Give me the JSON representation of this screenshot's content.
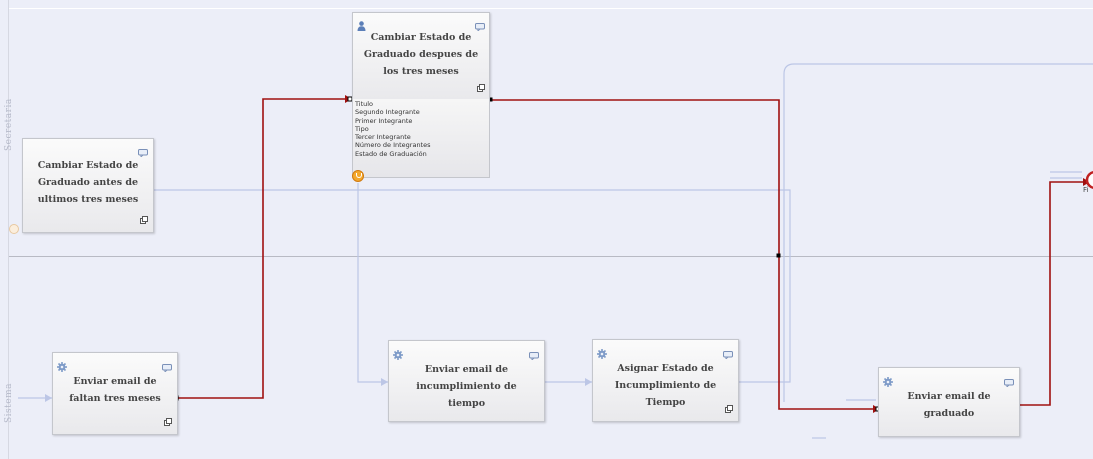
{
  "lanes": [
    {
      "name": "Secretaria"
    },
    {
      "name": "Sistema"
    }
  ],
  "tasks": {
    "update_after": {
      "title": "Cambiar Estado de Graduado despues de los tres meses",
      "icon": "user-icon"
    },
    "update_before": {
      "title": "Cambiar Estado de Graduado antes de ultimos tres meses"
    },
    "email_missing": {
      "title": "Enviar email de faltan tres meses",
      "icon": "gear-icon"
    },
    "email_timeout": {
      "title": "Enviar email de incumplimiento de tiempo",
      "icon": "gear-icon"
    },
    "assign_timeout": {
      "title": "Asignar Estado de Incumplimiento de Tiempo",
      "icon": "gear-icon"
    },
    "email_graduate": {
      "title": "Enviar email de graduado",
      "icon": "gear-icon"
    }
  },
  "attributes": [
    "Titulo",
    "Segundo Integrante",
    "Primer Integrante",
    "Tipo",
    "Tercer Integrante",
    "Número de Integrantes",
    "Estado de Graduación"
  ],
  "end_event_label": "Fi",
  "colors": {
    "canvas": "#eceef8",
    "flow_active": "#a01010",
    "flow_inactive": "#bcc6e6",
    "warning": "#f0a020"
  }
}
